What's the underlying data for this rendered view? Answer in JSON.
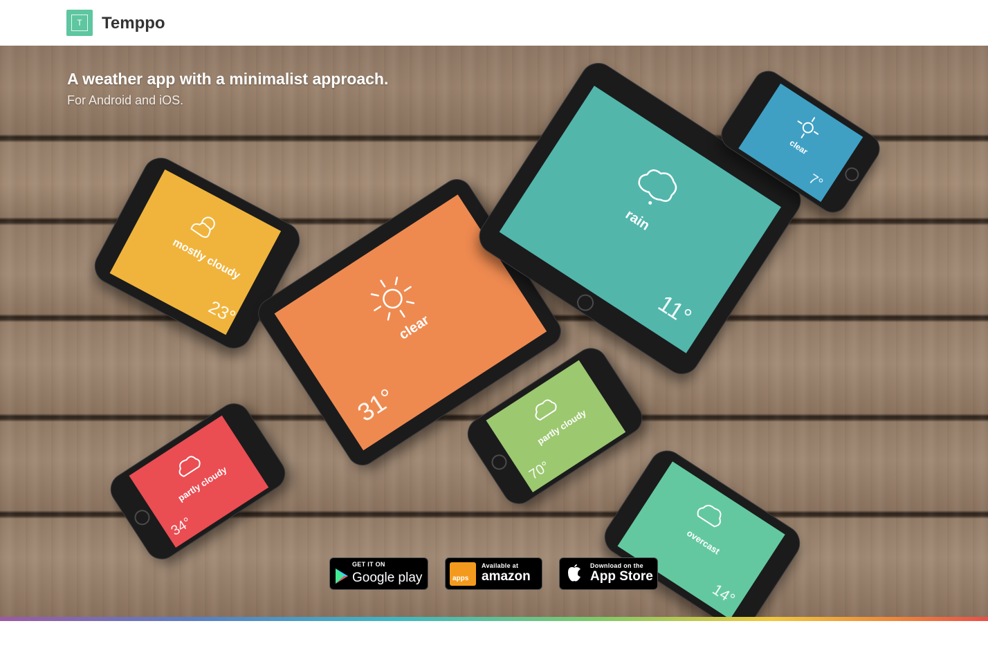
{
  "header": {
    "logo_letter": "T",
    "brand": "Temppo"
  },
  "hero": {
    "title": "A weather app with a minimalist approach.",
    "subtitle": "For Android and iOS."
  },
  "devices": [
    {
      "condition": "mostly cloudy",
      "temp": "23°",
      "color": "#f0b43c"
    },
    {
      "condition": "clear",
      "temp": "31°",
      "color": "#ee8a50"
    },
    {
      "condition": "rain",
      "temp": "11°",
      "color": "#52b6ab"
    },
    {
      "condition": "clear",
      "temp": "7°",
      "color": "#3fa0c4"
    },
    {
      "condition": "partly cloudy",
      "temp": "34°",
      "color": "#ea4d52"
    },
    {
      "condition": "partly cloudy",
      "temp": "70°",
      "color": "#9cc870"
    },
    {
      "condition": "overcast",
      "temp": "14°",
      "color": "#63c8a0"
    }
  ],
  "badges": {
    "google": {
      "small": "GET IT ON",
      "big": "Google play"
    },
    "amazon": {
      "small": "Available at",
      "big": "amazon",
      "tag": "apps"
    },
    "apple": {
      "small": "Download on the",
      "big": "App Store"
    }
  }
}
